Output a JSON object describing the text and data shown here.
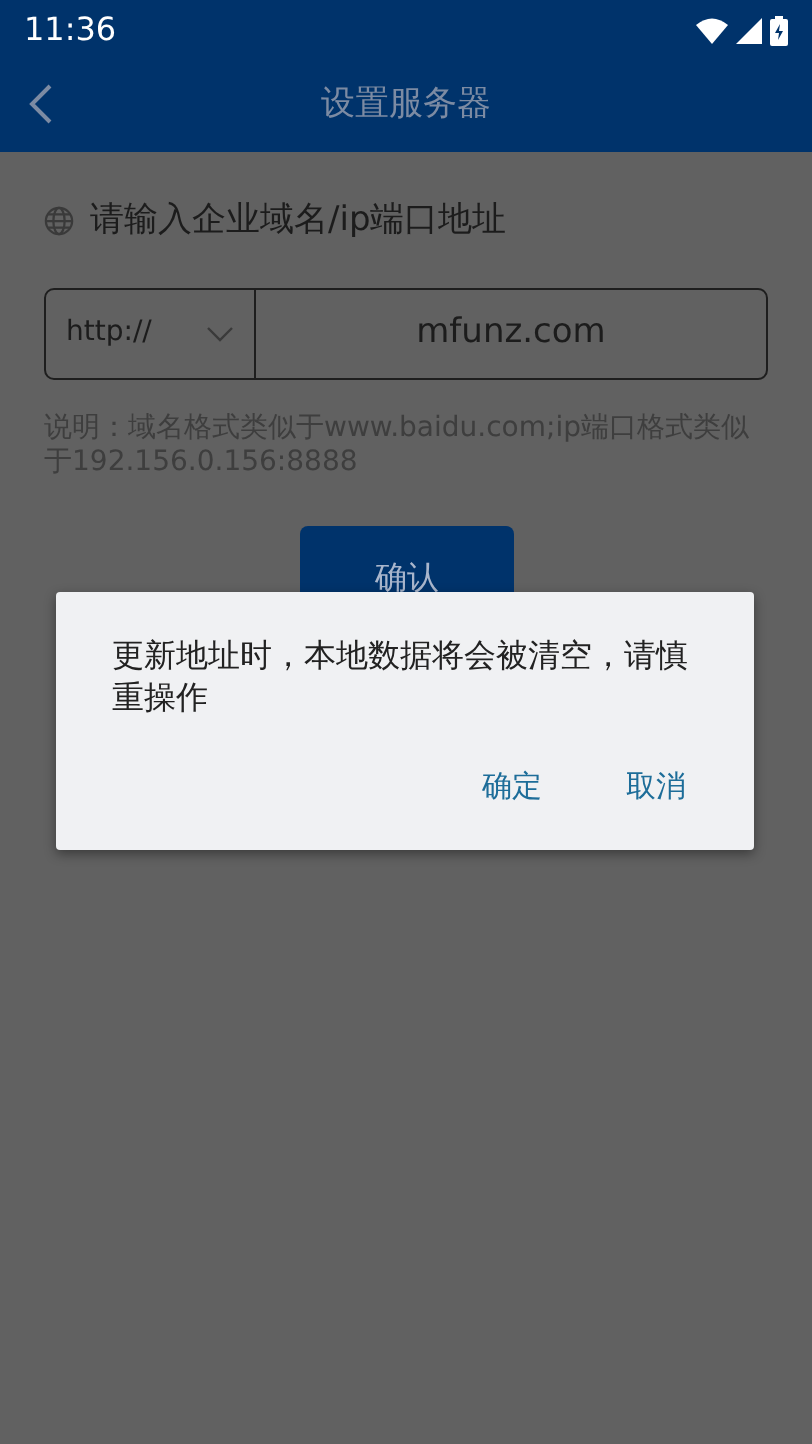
{
  "status_bar": {
    "time": "11:36"
  },
  "header": {
    "title": "设置服务器"
  },
  "form": {
    "label": "请输入企业域名/ip端口地址",
    "scheme": "http://",
    "address": "mfunz.com",
    "note": "说明：域名格式类似于www.baidu.com;ip端口格式类似于192.156.0.156:8888",
    "confirm_button": "确认"
  },
  "dialog": {
    "message": "更新地址时，本地数据将会被清空，请慎重操作",
    "buttons": [
      "确定",
      "取消"
    ]
  }
}
